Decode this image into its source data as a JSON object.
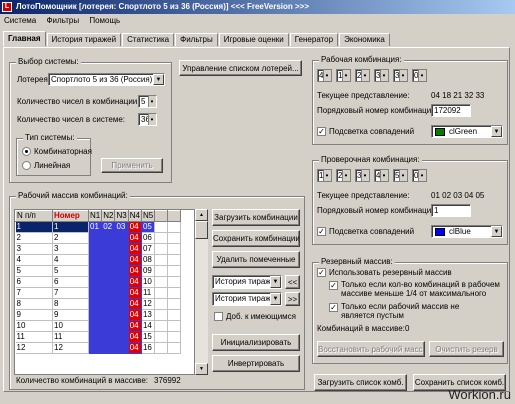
{
  "window": {
    "title": "ЛотоПомощник  [лотерея: Спортлото 5 из 36 (Россия)]     <<< FreeVersion >>>",
    "icon_label": "L"
  },
  "menu": [
    "Система",
    "Фильтры",
    "Помощь"
  ],
  "tabs": [
    "Главная",
    "История тиражей",
    "Статистика",
    "Фильтры",
    "Игровые оценки",
    "Генератор",
    "Экономика"
  ],
  "system": {
    "title": "Выбор системы:",
    "lottery_label": "Лотерея:",
    "lottery_value": "Спортлото 5 из 36 (Россия)",
    "count_label": "Количество чисел в комбинации:",
    "count_value": "5",
    "numbers_label": "Количество чисел в системе:",
    "numbers_value": "36",
    "type_title": "Тип системы:",
    "combo_label": "Комбинаторная",
    "linear_label": "Линейная",
    "apply": "Применить"
  },
  "manage_lotteries": "Управление списком лотерей...",
  "work_combo": {
    "title": "Рабочая комбинация:",
    "numbers": [
      "4",
      "18",
      "21",
      "32",
      "33",
      "0"
    ],
    "current_label": "Текущее представление:",
    "current_value": "04 18 21 32 33",
    "index_label": "Порядковый номер комбинации:",
    "index_value": "172092",
    "highlight_label": "Подсветка совпадений",
    "color_name": "clGreen",
    "color": "#008000"
  },
  "check_combo": {
    "title": "Проверочная комбинация:",
    "numbers": [
      "1",
      "2",
      "3",
      "4",
      "5",
      "0"
    ],
    "current_label": "Текущее представление:",
    "current_value": "01 02 03 04 05",
    "index_label": "Порядковый номер комбинации:",
    "index_value": "1",
    "highlight_label": "Подсветка совпадений",
    "color_name": "clBlue",
    "color": "#0000ff"
  },
  "reserve": {
    "title": "Резервный массив:",
    "use_label": "Использовать резервный массив",
    "only_if_less": "Только если кол-во комбинаций в рабочем массиве меньше 1/4 от максимального",
    "only_if_empty": "Только если рабочий массив не является пустым",
    "count_label": "Комбинаций в массиве:",
    "count_value": "0",
    "restore": "Восстановить рабочий массив",
    "clear": "Очистить резерв"
  },
  "work_array": {
    "title": "Рабочий массив комбинаций:",
    "headers": [
      "N п/п",
      "Номер",
      "N1",
      "N2",
      "N3",
      "N4",
      "N5"
    ],
    "rows": [
      [
        "1",
        "1",
        "01",
        "02",
        "03",
        "04",
        "05"
      ],
      [
        "2",
        "2",
        "",
        "",
        "",
        "04",
        "06"
      ],
      [
        "3",
        "3",
        "",
        "",
        "",
        "04",
        "07"
      ],
      [
        "4",
        "4",
        "",
        "",
        "",
        "04",
        "08"
      ],
      [
        "5",
        "5",
        "",
        "",
        "",
        "04",
        "09"
      ],
      [
        "6",
        "6",
        "",
        "",
        "",
        "04",
        "10"
      ],
      [
        "7",
        "7",
        "",
        "",
        "",
        "04",
        "11"
      ],
      [
        "8",
        "8",
        "",
        "",
        "",
        "04",
        "12"
      ],
      [
        "9",
        "9",
        "",
        "",
        "",
        "04",
        "13"
      ],
      [
        "10",
        "10",
        "",
        "",
        "",
        "04",
        "14"
      ],
      [
        "11",
        "11",
        "",
        "",
        "",
        "04",
        "15"
      ],
      [
        "12",
        "12",
        "",
        "",
        "",
        "04",
        "16"
      ]
    ],
    "count_label": "Количество комбинаций в массиве:",
    "count_value": "376992"
  },
  "actions": {
    "load": "Загрузить комбинации",
    "save": "Сохранить комбинации",
    "delete_marked": "Удалить помеченные",
    "history1": "История тиражей",
    "history2": "История тиражей",
    "prev": "<<",
    "next": ">>",
    "add_existing": "Доб. к имеющимся",
    "initialize": "Инициализировать",
    "invert": "Инвертировать"
  },
  "bottom": {
    "load_list": "Загрузить список комб.",
    "save_list": "Сохранить список комб."
  },
  "watermark": "Workion.ru"
}
